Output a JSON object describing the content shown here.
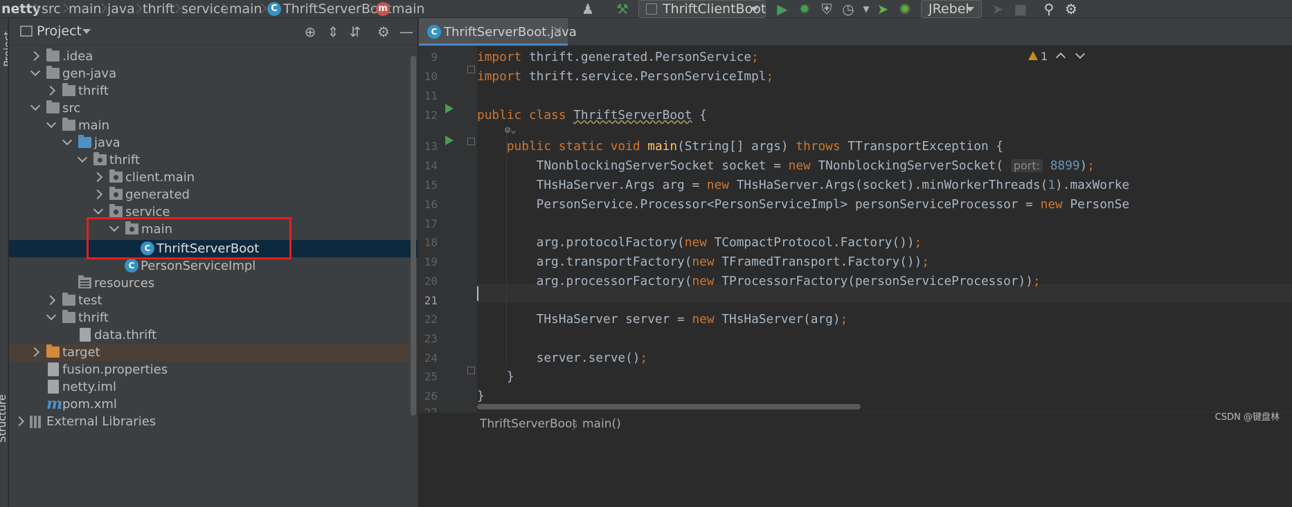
{
  "navbar": {
    "breadcrumbs": [
      "netty",
      "src",
      "main",
      "java",
      "thrift",
      "service",
      "main",
      "ThriftServerBoot",
      "main"
    ],
    "run_config": "ThriftClientBoot",
    "jrebel_label": "JRebel",
    "icons": [
      "user-icon",
      "build-hammer-icon",
      "run-icon",
      "debug-icon",
      "coverage-icon",
      "profile-icon",
      "jrebel-run-icon",
      "jrebel-debug-icon",
      "stop-icon",
      "search-icon",
      "settings-icon"
    ],
    "accent_color": "#499c54"
  },
  "sidebar_stripe": {
    "top_label": "Project",
    "bottom_label": "Structure"
  },
  "project": {
    "title": "Project",
    "tree": [
      {
        "label": ".idea",
        "kind": "folder",
        "expanded": false
      },
      {
        "label": "gen-java",
        "kind": "folder",
        "expanded": true
      },
      {
        "label": "thrift",
        "kind": "folder",
        "expanded": false
      },
      {
        "label": "src",
        "kind": "folder",
        "expanded": true
      },
      {
        "label": "main",
        "kind": "folder",
        "expanded": true
      },
      {
        "label": "java",
        "kind": "source-folder",
        "expanded": true
      },
      {
        "label": "thrift",
        "kind": "package",
        "expanded": true
      },
      {
        "label": "client.main",
        "kind": "package",
        "expanded": false
      },
      {
        "label": "generated",
        "kind": "package",
        "expanded": false
      },
      {
        "label": "service",
        "kind": "package",
        "expanded": true
      },
      {
        "label": "main",
        "kind": "package",
        "expanded": true
      },
      {
        "label": "ThriftServerBoot",
        "kind": "class",
        "selected": true
      },
      {
        "label": "PersonServiceImpl",
        "kind": "class"
      },
      {
        "label": "resources",
        "kind": "resource-folder"
      },
      {
        "label": "test",
        "kind": "folder",
        "expanded": false
      },
      {
        "label": "thrift",
        "kind": "folder",
        "expanded": true
      },
      {
        "label": "data.thrift",
        "kind": "file"
      },
      {
        "label": "target",
        "kind": "excluded-folder",
        "expanded": false
      },
      {
        "label": "fusion.properties",
        "kind": "file"
      },
      {
        "label": "netty.iml",
        "kind": "file"
      },
      {
        "label": "pom.xml",
        "kind": "maven-file"
      },
      {
        "label": "External Libraries",
        "kind": "libraries",
        "expanded": false
      }
    ],
    "highlight_box_color": "#e02020"
  },
  "editor": {
    "tab_label": "ThriftServerBoot.java",
    "warning_count": "1",
    "lines": [
      {
        "n": "9",
        "text": "import thrift.generated.PersonService;"
      },
      {
        "n": "10",
        "text": "import thrift.service.PersonServiceImpl;"
      },
      {
        "n": "11",
        "text": ""
      },
      {
        "n": "12",
        "text": "public class ThriftServerBoot {"
      },
      {
        "n": "13",
        "text": "    public static void main(String[] args) throws TTransportException {"
      },
      {
        "n": "14",
        "text": "        TNonblockingServerSocket socket = new TNonblockingServerSocket( port: 8899);"
      },
      {
        "n": "15",
        "text": "        THsHaServer.Args arg = new THsHaServer.Args(socket).minWorkerThreads(1).maxWorke"
      },
      {
        "n": "16",
        "text": "        PersonService.Processor<PersonServiceImpl> personServiceProcessor = new PersonSe"
      },
      {
        "n": "17",
        "text": ""
      },
      {
        "n": "18",
        "text": "        arg.protocolFactory(new TCompactProtocol.Factory());"
      },
      {
        "n": "19",
        "text": "        arg.transportFactory(new TFramedTransport.Factory());"
      },
      {
        "n": "20",
        "text": "        arg.processorFactory(new TProcessorFactory(personServiceProcessor));"
      },
      {
        "n": "21",
        "text": ""
      },
      {
        "n": "22",
        "text": "        THsHaServer server = new THsHaServer(arg);"
      },
      {
        "n": "23",
        "text": ""
      },
      {
        "n": "24",
        "text": "        server.serve();"
      },
      {
        "n": "25",
        "text": "    }"
      },
      {
        "n": "26",
        "text": "}"
      },
      {
        "n": "27",
        "text": ""
      }
    ],
    "current_line": "21",
    "breadcrumb": [
      "ThriftServerBoot",
      "main()"
    ],
    "keyword_color": "#cc7832",
    "method_color": "#ffc66d",
    "number_color": "#6897bb"
  },
  "watermark": "CSDN @键盘林"
}
